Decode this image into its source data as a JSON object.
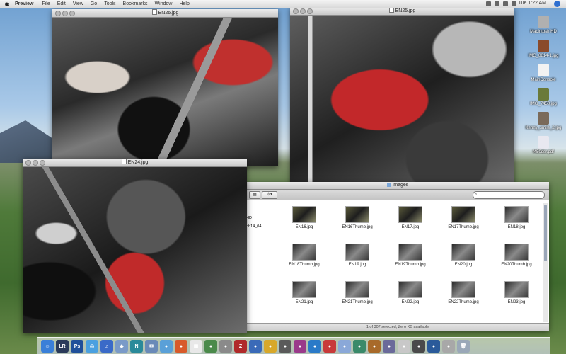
{
  "menubar": {
    "app": "Preview",
    "items": [
      "File",
      "Edit",
      "View",
      "Go",
      "Tools",
      "Bookmarks",
      "Window",
      "Help"
    ],
    "clock": "Tue 1:22 AM"
  },
  "windows": {
    "en26": {
      "title": "EN26.jpg"
    },
    "en25": {
      "title": "EN25.jpg"
    },
    "en24": {
      "title": "EN24.jpg"
    }
  },
  "finder": {
    "title": "images",
    "sidebar_fragments": [
      "HD",
      "pb14_04"
    ],
    "files": [
      {
        "name": "EN16.jpg",
        "tone": "a"
      },
      {
        "name": "EN16Thumb.jpg",
        "tone": "a"
      },
      {
        "name": "EN17.jpg",
        "tone": "a"
      },
      {
        "name": "EN17Thumb.jpg",
        "tone": "a"
      },
      {
        "name": "EN18.jpg",
        "tone": "b"
      },
      {
        "name": "EN18Thumb.jpg",
        "tone": "b"
      },
      {
        "name": "EN19.jpg",
        "tone": "b"
      },
      {
        "name": "EN19Thumb.jpg",
        "tone": "b"
      },
      {
        "name": "EN20.jpg",
        "tone": "b"
      },
      {
        "name": "EN20Thumb.jpg",
        "tone": "b"
      },
      {
        "name": "EN21.jpg",
        "tone": "b"
      },
      {
        "name": "EN21Thumb.jpg",
        "tone": "b"
      },
      {
        "name": "EN22.jpg",
        "tone": "b"
      },
      {
        "name": "EN22Thumb.jpg",
        "tone": "b"
      },
      {
        "name": "EN23.jpg",
        "tone": "b"
      }
    ],
    "status": "1 of 307 selected, Zero KB available"
  },
  "desktop_icons": [
    {
      "label": "Macintosh HD",
      "color": "#b0b0b0"
    },
    {
      "label": "IMG_8814-1.jpg",
      "color": "#8a4a2a"
    },
    {
      "label": "MainConsole",
      "color": "#f2f2f2"
    },
    {
      "label": "IMG_7450.jpg",
      "color": "#6a7a3a"
    },
    {
      "label": "Kenny_smile_2.jpg",
      "color": "#7a6a5a"
    },
    {
      "label": "f450dsr.pdf",
      "color": "#e8e8f0"
    }
  ],
  "dock": {
    "items": [
      {
        "icon": "finder-icon",
        "color": "#3a7fd8",
        "glyph": "☺"
      },
      {
        "icon": "lightroom-icon",
        "color": "#2a3a5a",
        "glyph": "LR"
      },
      {
        "icon": "photoshop-icon",
        "color": "#1f4f9a",
        "glyph": "Ps"
      },
      {
        "icon": "safari-icon",
        "color": "#4aa0e0",
        "glyph": "◎"
      },
      {
        "icon": "itunes-icon",
        "color": "#3a6ac8",
        "glyph": "♫"
      },
      {
        "icon": "iphoto-icon",
        "color": "#7a9ac8",
        "glyph": "◆"
      },
      {
        "icon": "nvu-icon",
        "color": "#2a8a9a",
        "glyph": "N"
      },
      {
        "icon": "mail-icon",
        "color": "#6a8ab8",
        "glyph": "✉"
      },
      {
        "icon": "app-icon",
        "color": "#5aa0d8",
        "glyph": "●"
      },
      {
        "icon": "app-icon",
        "color": "#d85a2a",
        "glyph": "●"
      },
      {
        "icon": "calendar-icon",
        "color": "#e8e8e8",
        "glyph": "▦"
      },
      {
        "icon": "app-icon",
        "color": "#4a8a4a",
        "glyph": "●"
      },
      {
        "icon": "app-icon",
        "color": "#8a8a8a",
        "glyph": "●"
      },
      {
        "icon": "filezilla-icon",
        "color": "#b02a2a",
        "glyph": "Z"
      },
      {
        "icon": "app-icon",
        "color": "#3a6ab8",
        "glyph": "●"
      },
      {
        "icon": "app-icon",
        "color": "#d8a82a",
        "glyph": "●"
      },
      {
        "icon": "app-icon",
        "color": "#5a5a5a",
        "glyph": "●"
      },
      {
        "icon": "app-icon",
        "color": "#9a3a8a",
        "glyph": "●"
      },
      {
        "icon": "app-icon",
        "color": "#2a7ac8",
        "glyph": "●"
      },
      {
        "icon": "app-icon",
        "color": "#c83a3a",
        "glyph": "●"
      },
      {
        "icon": "app-icon",
        "color": "#8aa8d8",
        "glyph": "●"
      },
      {
        "icon": "app-icon",
        "color": "#3a8a6a",
        "glyph": "●"
      },
      {
        "icon": "app-icon",
        "color": "#a86a2a",
        "glyph": "●"
      },
      {
        "icon": "app-icon",
        "color": "#6a6a9a",
        "glyph": "●"
      },
      {
        "icon": "app-icon",
        "color": "#c8c8c8",
        "glyph": "●"
      },
      {
        "icon": "app-icon",
        "color": "#4a4a4a",
        "glyph": "●"
      },
      {
        "icon": "app-icon",
        "color": "#2a5a9a",
        "glyph": "●"
      },
      {
        "icon": "app-icon",
        "color": "#a8a8a8",
        "glyph": "●"
      },
      {
        "icon": "trash-icon",
        "color": "#9aa8b8",
        "glyph": "🗑"
      }
    ]
  }
}
